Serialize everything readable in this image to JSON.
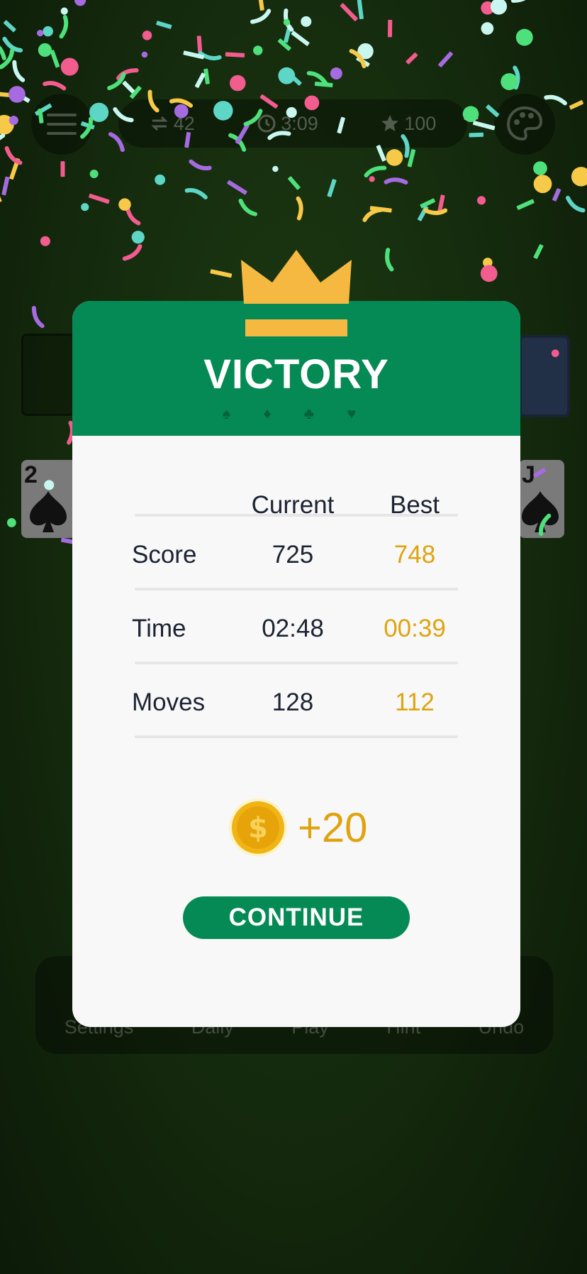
{
  "background": {
    "stats": {
      "moves": "42",
      "time": "3:09",
      "score": "100"
    },
    "cards": {
      "left_rank": "2",
      "right_rank": "J"
    },
    "bottom_nav": [
      {
        "label": "Settings"
      },
      {
        "label": "Daily"
      },
      {
        "label": "Play"
      },
      {
        "label": "Hint"
      },
      {
        "label": "Undo"
      }
    ]
  },
  "dialog": {
    "title": "VICTORY",
    "suits": "♠ ♦ ♣ ♥",
    "columns": {
      "current": "Current",
      "best": "Best"
    },
    "rows": [
      {
        "label": "Score",
        "current": "725",
        "best": "748"
      },
      {
        "label": "Time",
        "current": "02:48",
        "best": "00:39"
      },
      {
        "label": "Moves",
        "current": "128",
        "best": "112"
      }
    ],
    "reward": {
      "amount": "+20",
      "icon": "coin-icon"
    },
    "continue_label": "CONTINUE"
  },
  "colors": {
    "primary_green": "#058a55",
    "gold": "#e0a310",
    "crown": "#f5b942",
    "confetti": [
      "#f25c8e",
      "#5dd6c6",
      "#f7c948",
      "#a66be0",
      "#4ee07a",
      "#c9f7f0"
    ]
  }
}
